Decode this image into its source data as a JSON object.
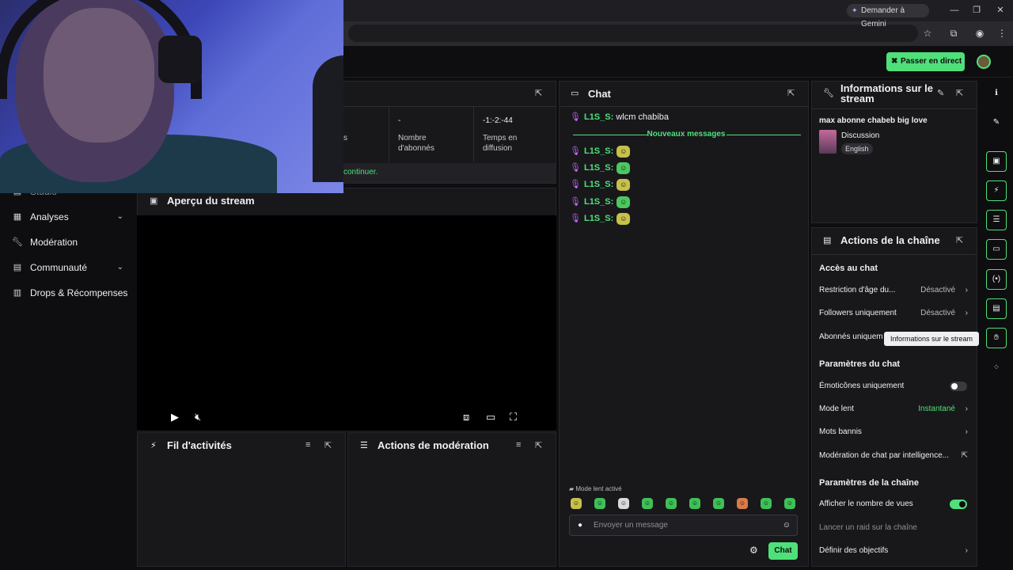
{
  "browser": {
    "gemini_label": "Demander à Gemini",
    "window_controls": [
      "—",
      "❐",
      "✕"
    ],
    "omnibar_icons": [
      "star-icon",
      "extensions-icon",
      "profile-icon",
      "menu-icon"
    ]
  },
  "topbar": {
    "go_live_label": "Passer en direct"
  },
  "sidebar": {
    "partial_item": "Studio",
    "items": [
      {
        "label": "Analyses",
        "icon": "chart-icon",
        "chevron": true
      },
      {
        "label": "Modération",
        "icon": "wrench-icon",
        "chevron": false
      },
      {
        "label": "Communauté",
        "icon": "community-icon",
        "chevron": true
      },
      {
        "label": "Drops & Récompenses",
        "icon": "gift-icon",
        "chevron": false
      }
    ]
  },
  "stats": {
    "partial_label": "s",
    "followers_value": "-",
    "followers_label_1": "Nombre",
    "followers_label_2": "d'abonnés",
    "time_value": "-1:-2:-44",
    "time_label_1": "Temps en",
    "time_label_2": "diffusion",
    "notice": "continuer."
  },
  "preview": {
    "title": "Aperçu du stream"
  },
  "activity": {
    "title": "Fil d'activités"
  },
  "mod_actions": {
    "title": "Actions de modération"
  },
  "chat": {
    "title": "Chat",
    "first_user": "L1S_S:",
    "first_text": "wlcm chabiba",
    "new_messages": "Nouveaux messages",
    "emote_messages": [
      {
        "user": "L1S_S:",
        "emote": "yellow"
      },
      {
        "user": "L1S_S:",
        "emote": "green"
      },
      {
        "user": "L1S_S:",
        "emote": "yellow"
      },
      {
        "user": "L1S_S:",
        "emote": "green"
      },
      {
        "user": "L1S_S:",
        "emote": "yellow"
      }
    ],
    "slow_mode_notice": "Mode lent activé",
    "input_placeholder": "Envoyer un message",
    "send_label": "Chat"
  },
  "stream_info": {
    "title": "Informations sur le stream",
    "stream_title": "max abonne chabeb big love",
    "category": "Discussion",
    "tag": "English"
  },
  "channel_actions": {
    "title": "Actions de la chaîne",
    "chat_access": {
      "heading": "Accès au chat",
      "age_restriction": "Restriction d'âge du...",
      "age_value": "Désactivé",
      "followers_only": "Followers uniquement",
      "followers_value": "Désactivé",
      "subs_only": "Abonnés uniquem"
    },
    "chat_settings": {
      "heading": "Paramètres du chat",
      "emotes_only": "Émoticônes uniquement",
      "emotes_only_on": false,
      "slow_mode": "Mode lent",
      "slow_mode_value": "Instantané",
      "banned_words": "Mots bannis",
      "ai_moderation": "Modération de chat par intelligence..."
    },
    "channel_settings": {
      "heading": "Paramètres de la chaîne",
      "show_viewers": "Afficher le nombre de vues",
      "show_viewers_on": true,
      "raid": "Lancer un raid sur la chaîne",
      "goals": "Définir des objectifs"
    }
  },
  "rail": {
    "tooltip": "Informations sur le stream"
  },
  "colors": {
    "accent": "#4fe07a",
    "background": "#0e0e10",
    "panel": "#18181b",
    "mic": "#c468ff"
  }
}
